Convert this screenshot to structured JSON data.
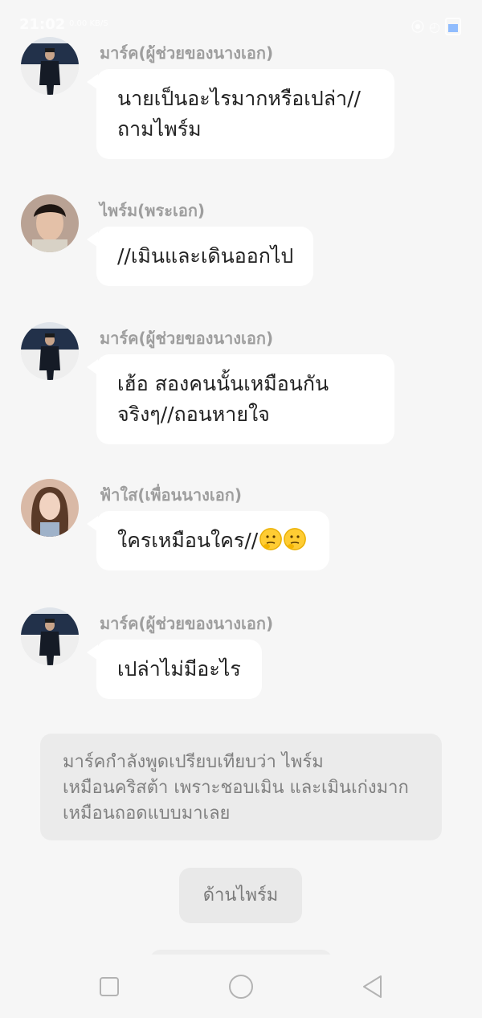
{
  "status_bar": {
    "time": "21:02",
    "network_speed": "0.00 KB/S"
  },
  "messages": [
    {
      "sender": "มาร์ค(ผู้ช่วยของนางเอก)",
      "avatar": "man-in-suit-avatar",
      "lines": [
        "นายเป็นอะไรมากหรือเปล่า//",
        "ถามไพร์ม"
      ]
    },
    {
      "sender": "ไพร์ม(พระเอก)",
      "avatar": "young-man-avatar",
      "lines": [
        "//เมินและเดินออกไป"
      ]
    },
    {
      "sender": "มาร์ค(ผู้ช่วยของนางเอก)",
      "avatar": "man-in-suit-avatar",
      "lines": [
        "เฮ้อ สองคนนั้นเหมือนกัน",
        "จริงๆ//ถอนหายใจ"
      ]
    },
    {
      "sender": "ฟ้าใส(เพื่อนนางเอก)",
      "avatar": "young-woman-avatar",
      "lines": [
        "ใครเหมือนใคร//"
      ],
      "emoji": "thinking-face-emoji"
    },
    {
      "sender": "มาร์ค(ผู้ช่วยของนางเอก)",
      "avatar": "man-in-suit-avatar",
      "lines": [
        "เปล่าไม่มีอะไร"
      ]
    }
  ],
  "narration": {
    "lines": [
      "มาร์คกำลังพูดเปรียบเทียบว่า ไพร์ม",
      "เหมือนคริสต้า เพราะชอบเมิน และเมินเก่งมาก",
      "เหมือนถอดแบบมาเลย"
    ]
  },
  "choice": {
    "label": "ด้านไพร์ม"
  },
  "nav": {
    "icons": [
      "square-recent-apps-icon",
      "circle-home-icon",
      "triangle-back-icon"
    ]
  },
  "colors": {
    "background": "#f6f6f6",
    "bubble": "#ffffff",
    "sender_text": "#9e9e9e",
    "message_text": "#222222",
    "narration_bg": "#ebebeb",
    "narration_text": "#808080"
  }
}
